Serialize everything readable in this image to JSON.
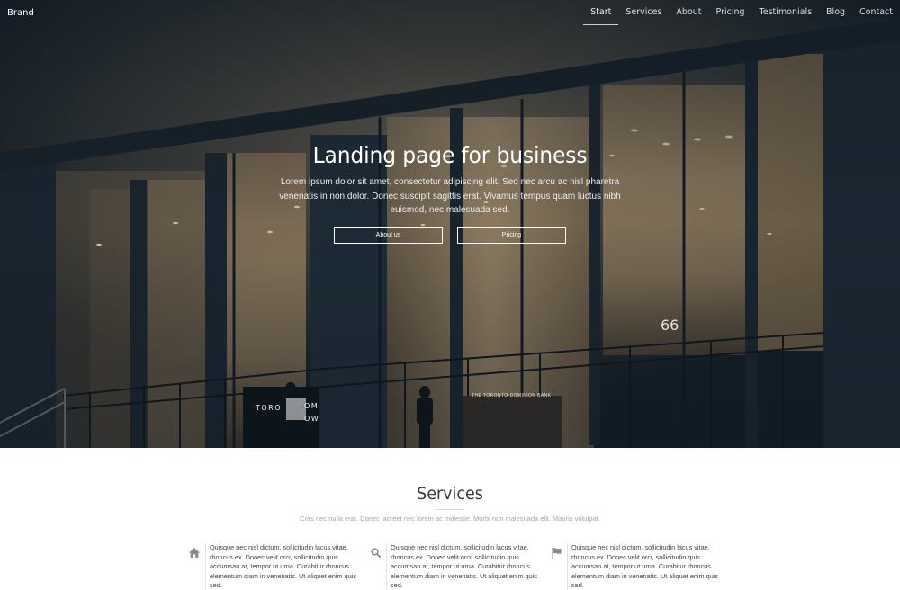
{
  "navbar": {
    "brand": "Brand",
    "items": [
      {
        "label": "Start",
        "active": true
      },
      {
        "label": "Services"
      },
      {
        "label": "About"
      },
      {
        "label": "Pricing"
      },
      {
        "label": "Testimonials"
      },
      {
        "label": "Blog"
      },
      {
        "label": "Contact"
      }
    ]
  },
  "hero": {
    "title": "Landing page for business",
    "text": "Lorem ipsum dolor sit amet, consectetur adipiscing elit. Sed nec arcu ac nisl pharetra venenatis in non dolor. Donec suscipit sagittis erat. Vivamus tempus quam luctus nibh euismod, nec malesuada sed.",
    "buttons": {
      "about": "About us",
      "pricing": "Pricing"
    },
    "image_text": {
      "building_number": "66",
      "bank_sign": "THE TORONTO-DOMINION BANK",
      "sign_line1": "TORO",
      "sign_line2": "OM",
      "sign_line3": "OW"
    }
  },
  "services": {
    "title": "Services",
    "subtitle": "Cras nec nulla erat. Donec laoreet nec lorem ac molestie. Morbi non malesuada elit. Mauris volutpat.",
    "cards": [
      {
        "icon": "home-icon",
        "text": "Quisque nec nisl dictum, sollicitudin lacus vitae, rhoncus ex. Donec velit orci, sollicitudin quis accumsan at, tempor ut urna. Curabitur rhoncus elementum diam in venenatis. Ut aliquet enim quis sed."
      },
      {
        "icon": "search-icon",
        "text": "Quisque nec nisl dictum, sollicitudin lacus vitae, rhoncus ex. Donec velit orci, sollicitudin quis accumsan at, tempor ut urna. Curabitur rhoncus elementum diam in venenatis. Ut aliquet enim quis sed."
      },
      {
        "icon": "flag-icon",
        "text": "Quisque nec nisl dictum, sollicitudin lacus vitae, rhoncus ex. Donec velit orci, sollicitudin quis accumsan at, tempor ut urna. Curabitur rhoncus elementum diam in venenatis. Ut aliquet enim quis sed."
      }
    ]
  },
  "colors": {
    "hero_overlay": "#15202a",
    "warm_light": "#b89a6c",
    "accent_white": "#ffffff"
  }
}
